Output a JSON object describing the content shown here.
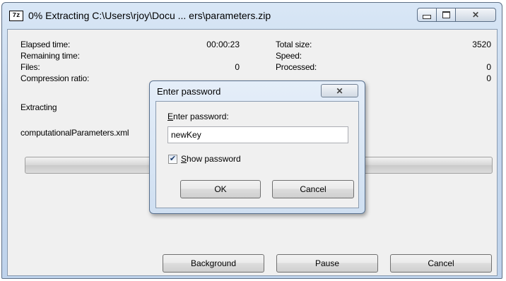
{
  "window": {
    "title": "0% Extracting C:\\Users\\rjoy\\Docu ... ers\\parameters.zip",
    "app_icon_text": "7z"
  },
  "stats": {
    "elapsed_label": "Elapsed time:",
    "elapsed_value": "00:00:23",
    "remaining_label": "Remaining time:",
    "files_label": "Files:",
    "files_value": "0",
    "ratio_label": "Compression ratio:",
    "total_label": "Total size:",
    "total_value": "3520",
    "speed_label": "Speed:",
    "processed_label": "Processed:",
    "processed_value": "0",
    "compressed_value": "0"
  },
  "status": {
    "operation": "Extracting",
    "current_file": "computationalParameters.xml",
    "progress_percent": 0
  },
  "buttons": {
    "background": "Background",
    "pause": "Pause",
    "cancel": "Cancel"
  },
  "dialog": {
    "title": "Enter password",
    "label_accel": "E",
    "label_rest": "nter password:",
    "password_value": "newKey",
    "show_accel": "S",
    "show_rest": "how password",
    "show_checked": true,
    "ok": "OK",
    "cancel": "Cancel"
  }
}
